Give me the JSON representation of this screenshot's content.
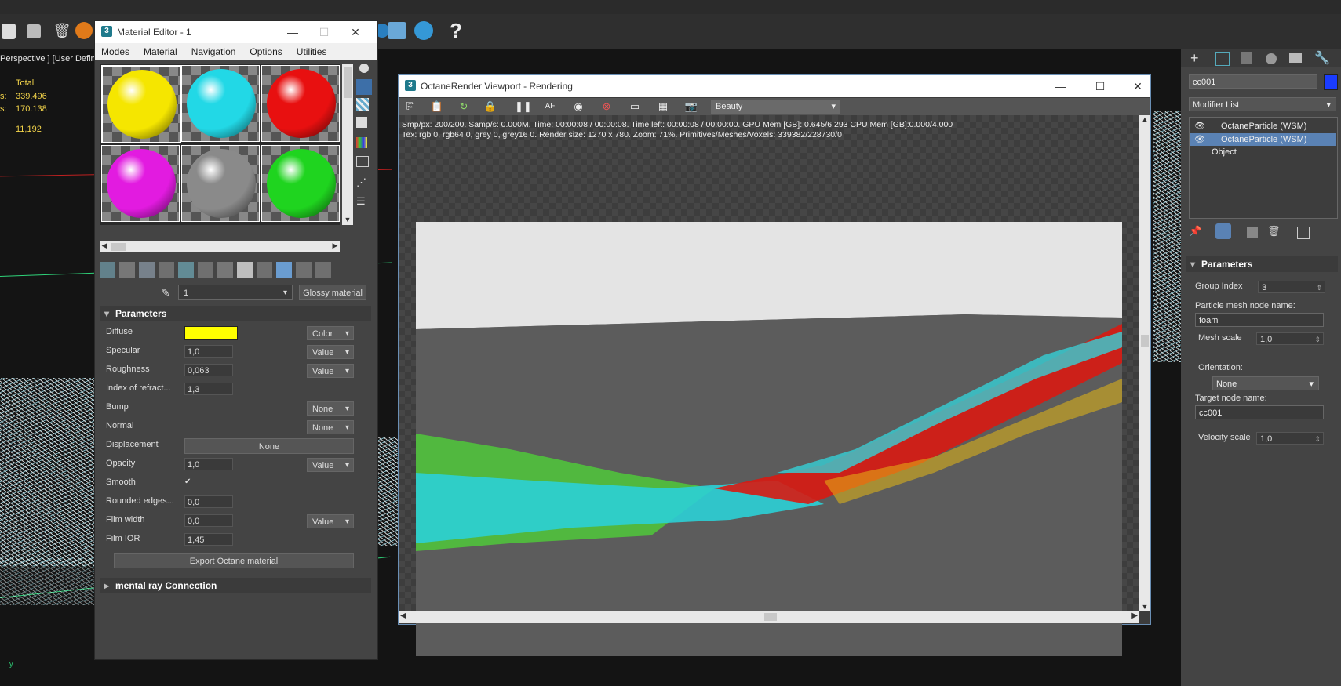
{
  "viewport": {
    "label": "Perspective ] [User Defined",
    "stats": {
      "total": "Total",
      "polys_label": "s:",
      "polys": "339.496",
      "verts_label": "s:",
      "verts": "170.138",
      "fps": "11,192"
    },
    "axis": "y"
  },
  "material_editor": {
    "title": "Material Editor - 1",
    "menu": [
      "Modes",
      "Material",
      "Navigation",
      "Options",
      "Utilities"
    ],
    "slot_colors": [
      "#f5e600",
      "#22d8e6",
      "#e81010",
      "#e21be0",
      "#8a8a8a",
      "#1fd41f"
    ],
    "material_name": "1",
    "material_type": "Glossy material",
    "parameters_header": "Parameters",
    "params": [
      {
        "label": "Diffuse",
        "swatch": "#ffff00",
        "mode": "Color"
      },
      {
        "label": "Specular",
        "value": "1,0",
        "mode": "Value"
      },
      {
        "label": "Roughness",
        "value": "0,063",
        "mode": "Value"
      },
      {
        "label": "Index of refract...",
        "value": "1,3"
      },
      {
        "label": "Bump",
        "mode": "None"
      },
      {
        "label": "Normal",
        "mode": "None"
      },
      {
        "label": "Displacement",
        "button": "None"
      },
      {
        "label": "Opacity",
        "value": "1,0",
        "mode": "Value"
      },
      {
        "label": "Smooth",
        "checked": "✔"
      },
      {
        "label": "Rounded edges...",
        "value": "0,0"
      },
      {
        "label": "Film width",
        "value": "0,0",
        "mode": "Value"
      },
      {
        "label": "Film IOR",
        "value": "1,45"
      }
    ],
    "export_button": "Export Octane material",
    "mental_ray": "mental ray Connection"
  },
  "octane": {
    "title": "OctaneRender Viewport - Rendering",
    "pass": "Beauty",
    "info_line1": "Smp/px: 200/200.   Samp/s: 0.000M.   Time: 00:00:08 / 00:00:08.   Time left: 00:00:08 / 00:00:00.   GPU Mem [GB]: 0.645/6.293   CPU Mem [GB]:0.000/4.000",
    "info_line2": "Tex: rgb 0, rgb64 0, grey 0, grey16 0.   Render size: 1270 x 780.   Zoom: 71%.   Primitives/Meshes/Voxels: 339382/228730/0"
  },
  "command_panel": {
    "object_name": "cc001",
    "object_color": "#1a3cff",
    "modifier_list": "Modifier List",
    "stack": [
      "OctaneParticle (WSM)",
      "OctaneParticle (WSM)",
      "Object"
    ],
    "parameters_header": "Parameters",
    "group_index_label": "Group Index",
    "group_index": "3",
    "particle_mesh_label": "Particle mesh node name:",
    "particle_mesh": "foam",
    "mesh_scale_label": "Mesh scale",
    "mesh_scale": "1,0",
    "orientation_label": "Orientation:",
    "orientation": "None",
    "target_node_label": "Target node name:",
    "target_node": "cc001",
    "velocity_scale_label": "Velocity scale",
    "velocity_scale": "1,0"
  }
}
